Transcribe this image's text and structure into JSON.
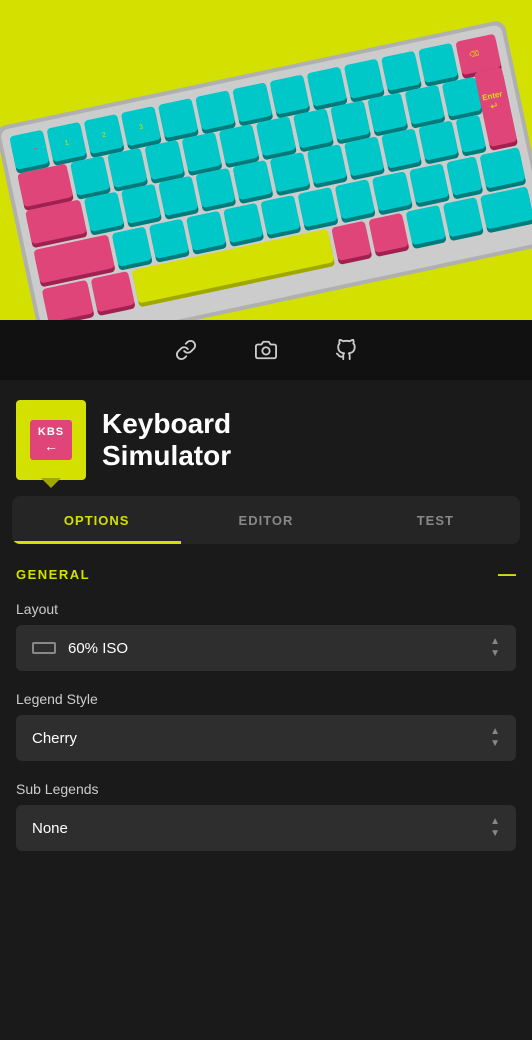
{
  "hero": {
    "bg_color": "#d4e000"
  },
  "toolbar": {
    "icons": [
      {
        "name": "link-icon",
        "label": "Link"
      },
      {
        "name": "camera-icon",
        "label": "Camera"
      },
      {
        "name": "github-icon",
        "label": "GitHub"
      }
    ]
  },
  "app": {
    "logo_kbs": "KBS",
    "logo_arrow": "←",
    "title_line1": "Keyboard",
    "title_line2": "Simulator"
  },
  "tabs": [
    {
      "id": "options",
      "label": "OPTIONS",
      "active": true
    },
    {
      "id": "editor",
      "label": "EDITOR",
      "active": false
    },
    {
      "id": "test",
      "label": "TEST",
      "active": false
    }
  ],
  "options": {
    "section_title": "GENERAL",
    "section_toggle": "—",
    "fields": [
      {
        "id": "layout",
        "label": "Layout",
        "value": "60% ISO",
        "has_icon": true
      },
      {
        "id": "legend_style",
        "label": "Legend Style",
        "value": "Cherry",
        "has_icon": false
      },
      {
        "id": "sub_legends",
        "label": "Sub Legends",
        "value": "None",
        "has_icon": false
      }
    ]
  },
  "colors": {
    "accent": "#d4e000",
    "bg_dark": "#1a1a1a",
    "bg_medium": "#252525",
    "bg_field": "#2e2e2e",
    "text_primary": "#ffffff",
    "text_secondary": "#cccccc",
    "text_muted": "#888888"
  }
}
